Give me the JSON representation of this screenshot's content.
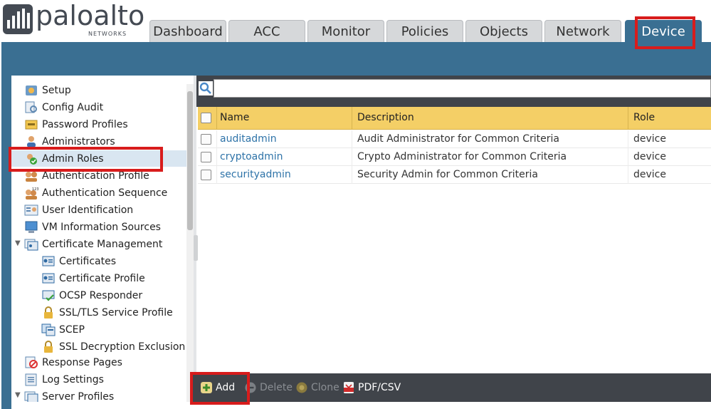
{
  "brand": {
    "name": "paloalto",
    "sub": "NETWORKS"
  },
  "tabs": [
    {
      "label": "Dashboard"
    },
    {
      "label": "ACC"
    },
    {
      "label": "Monitor"
    },
    {
      "label": "Policies"
    },
    {
      "label": "Objects"
    },
    {
      "label": "Network"
    },
    {
      "label": "Device",
      "active": true
    }
  ],
  "sidebar": {
    "items": [
      {
        "label": "Setup",
        "icon": "setup-icon"
      },
      {
        "label": "Config Audit",
        "icon": "config-audit-icon"
      },
      {
        "label": "Password Profiles",
        "icon": "password-profiles-icon"
      },
      {
        "label": "Administrators",
        "icon": "administrators-icon"
      },
      {
        "label": "Admin Roles",
        "icon": "admin-roles-icon",
        "selected": true
      },
      {
        "label": "Authentication Profile",
        "icon": "authentication-profile-icon"
      },
      {
        "label": "Authentication Sequence",
        "icon": "authentication-sequence-icon"
      },
      {
        "label": "User Identification",
        "icon": "user-identification-icon"
      },
      {
        "label": "VM Information Sources",
        "icon": "vm-information-icon"
      },
      {
        "label": "Certificate Management",
        "icon": "certificate-management-icon",
        "expanded": true
      },
      {
        "label": "Certificates",
        "icon": "certificate-icon",
        "child": true
      },
      {
        "label": "Certificate Profile",
        "icon": "certificate-icon",
        "child": true
      },
      {
        "label": "OCSP Responder",
        "icon": "ocsp-icon",
        "child": true
      },
      {
        "label": "SSL/TLS Service Profile",
        "icon": "lock-icon",
        "child": true
      },
      {
        "label": "SCEP",
        "icon": "scep-icon",
        "child": true
      },
      {
        "label": "SSL Decryption Exclusion",
        "icon": "lock-icon",
        "child": true
      },
      {
        "label": "Response Pages",
        "icon": "response-pages-icon"
      },
      {
        "label": "Log Settings",
        "icon": "log-settings-icon"
      },
      {
        "label": "Server Profiles",
        "icon": "server-profiles-icon",
        "expanded": true
      }
    ]
  },
  "search": {
    "placeholder": ""
  },
  "grid": {
    "columns": [
      "Name",
      "Description",
      "Role"
    ],
    "rows": [
      {
        "name": "auditadmin",
        "description": "Audit Administrator for Common Criteria",
        "role": "device"
      },
      {
        "name": "cryptoadmin",
        "description": "Crypto Administrator for Common Criteria",
        "role": "device"
      },
      {
        "name": "securityadmin",
        "description": "Security Admin for Common Criteria",
        "role": "device"
      }
    ]
  },
  "toolbar": {
    "add": "Add",
    "delete": "Delete",
    "clone": "Clone",
    "pdf": "PDF/CSV"
  },
  "colors": {
    "brand_blue": "#3a6f92",
    "header_yellow": "#f4cf66",
    "highlight_red": "#d81c1c",
    "link_blue": "#2e73a8",
    "toolbar_dark": "#40444a"
  }
}
